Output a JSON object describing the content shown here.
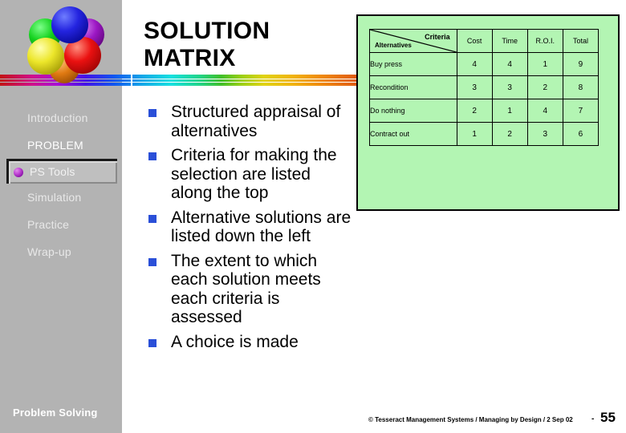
{
  "slide": {
    "title": "SOLUTION\nMATRIX",
    "title_line1": "SOLUTION",
    "title_line2": "MATRIX"
  },
  "logo": {
    "name": "sphere-cluster-logo",
    "spheres": [
      {
        "name": "blue-sphere",
        "color": "#2424e0"
      },
      {
        "name": "green-sphere",
        "color": "#14d21e"
      },
      {
        "name": "purple-sphere",
        "color": "#9c17c4"
      },
      {
        "name": "yellow-sphere",
        "color": "#ece62a"
      },
      {
        "name": "red-sphere",
        "color": "#ea1111"
      },
      {
        "name": "orange-sphere",
        "color": "#e07a12"
      }
    ]
  },
  "sidebar": {
    "background": "#b3b3b3",
    "footer_label": "Problem Solving",
    "items": [
      {
        "label": "Introduction",
        "current": false
      },
      {
        "label": "PROBLEM",
        "current": false
      },
      {
        "label": "PS Tools",
        "current": true
      },
      {
        "label": "Simulation",
        "current": false
      },
      {
        "label": "Practice",
        "current": false
      },
      {
        "label": "Wrap-up",
        "current": false
      }
    ]
  },
  "bullets": {
    "marker_color": "#2a4fd8",
    "items": [
      "Structured appraisal of alternatives",
      "Criteria for making the selection are listed along the top",
      "Alternative solutions are listed down the left",
      "The extent to which each solution meets each criteria is assessed",
      "A choice is made"
    ]
  },
  "matrix": {
    "panel_color": "#b3f5b3",
    "corner": {
      "criteria_label": "Criteria",
      "alternatives_label": "Alternatives"
    },
    "columns": [
      "Cost",
      "Time",
      "R.O.I.",
      "Total"
    ],
    "rows": [
      {
        "label": "Buy press",
        "values": [
          "4",
          "4",
          "1",
          "9"
        ]
      },
      {
        "label": "Recondition",
        "values": [
          "3",
          "3",
          "2",
          "8"
        ]
      },
      {
        "label": "Do nothing",
        "values": [
          "2",
          "1",
          "4",
          "7"
        ]
      },
      {
        "label": "Contract out",
        "values": [
          "1",
          "2",
          "3",
          "6"
        ]
      }
    ]
  },
  "footer": {
    "copyright": "© Tesseract Management Systems / Managing by Design / 2 Sep 02",
    "dash": "-",
    "page_number": "55"
  }
}
